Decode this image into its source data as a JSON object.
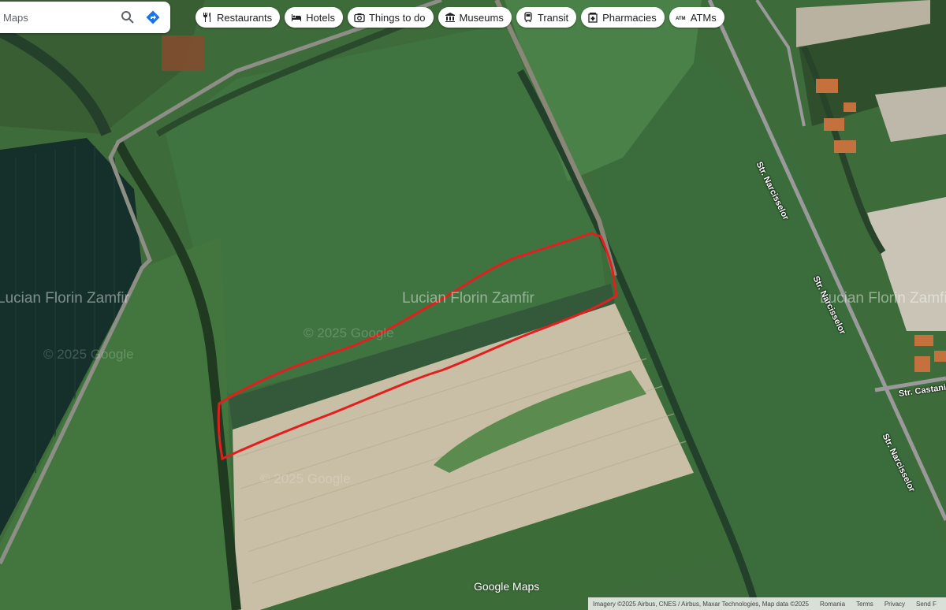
{
  "search": {
    "placeholder": "Maps"
  },
  "chips": [
    {
      "label": "Restaurants",
      "icon": "fork-knife-icon"
    },
    {
      "label": "Hotels",
      "icon": "bed-icon"
    },
    {
      "label": "Things to do",
      "icon": "camera-icon"
    },
    {
      "label": "Museums",
      "icon": "museum-icon"
    },
    {
      "label": "Transit",
      "icon": "train-icon"
    },
    {
      "label": "Pharmacies",
      "icon": "pharmacy-icon"
    },
    {
      "label": "ATMs",
      "icon": "atm-icon"
    }
  ],
  "watermarks": [
    "Lucian Florin Zamfir",
    "© 2025 Google"
  ],
  "roads": {
    "narcisselor": "Str. Narcisselor",
    "castanilor": "Str. Castanil"
  },
  "map": {
    "logo": "Google Maps"
  },
  "footer": {
    "attribution": "Imagery ©2025 Airbus, CNES / Airbus, Maxar Technologies, Map data ©2025",
    "country": "Romania",
    "terms": "Terms",
    "privacy": "Privacy",
    "feedback": "Send F"
  },
  "colors": {
    "outline": "#e41e1e",
    "accent": "#1a73e8"
  }
}
